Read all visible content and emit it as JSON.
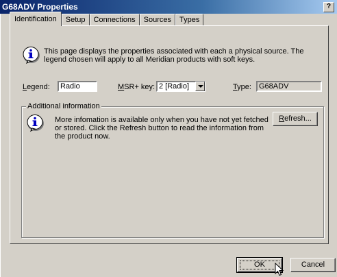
{
  "window": {
    "title": "G68ADV Properties",
    "help_glyph": "?"
  },
  "tabs": [
    {
      "label": "Identification",
      "active": true
    },
    {
      "label": "Setup",
      "active": false
    },
    {
      "label": "Connections",
      "active": false
    },
    {
      "label": "Sources",
      "active": false
    },
    {
      "label": "Types",
      "active": false
    }
  ],
  "intro": {
    "icon": "info-icon",
    "text": "This page displays the properties associated with each a physical source. The legend chosen will apply to all Meridian products with soft keys."
  },
  "fields": {
    "legend_label_accel": "L",
    "legend_label_rest": "egend:",
    "legend_value": "Radio",
    "msr_label_accel": "M",
    "msr_label_rest": "SR+ key:",
    "msr_value": "2 [Radio]",
    "type_label_accel": "T",
    "type_label_rest": "ype:",
    "type_value": "G68ADV"
  },
  "additional": {
    "title": "Additional information",
    "icon": "info-icon",
    "text": "More infomation is available only when you have not yet fetched or stored. Click the Refresh button to read the information from the product now.",
    "refresh_accel": "R",
    "refresh_rest": "efresh..."
  },
  "footer": {
    "ok_label": "OK",
    "cancel_label": "Cancel"
  },
  "colors": {
    "titlebar_start": "#0a246a",
    "face": "#d4d0c8"
  }
}
